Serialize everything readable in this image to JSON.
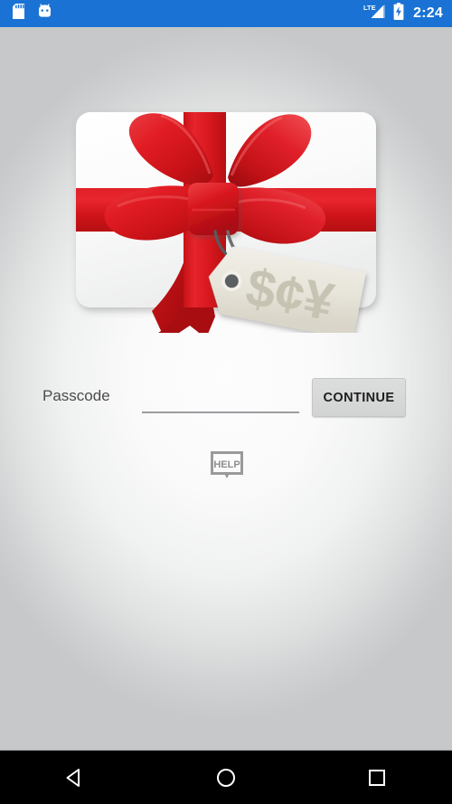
{
  "status_bar": {
    "background_color": "#1a73d4",
    "clock": "2:24",
    "left_icons": [
      {
        "name": "sd-card-icon",
        "label": "SD card"
      },
      {
        "name": "android-head-icon",
        "label": "Android system"
      }
    ],
    "right_icons": [
      {
        "name": "lte-signal-icon",
        "label": "LTE",
        "signal_text": "LTE"
      },
      {
        "name": "battery-charging-icon",
        "label": "Battery charging"
      }
    ]
  },
  "illustration": {
    "name": "gift-card-with-bow-and-price-tag",
    "alt": "White gift card wrapped in a red ribbon bow with a beige price tag",
    "tag_text": "$¢¥",
    "ribbon_color": "#d81921",
    "ribbon_dark_color": "#a50f14",
    "card_color": "#fbfbfb",
    "tag_color": "#e9e6dd",
    "tag_text_color": "#c7c3b2"
  },
  "form": {
    "passcode_label": "Passcode",
    "passcode_value": "",
    "passcode_placeholder": "",
    "continue_label": "CONTINUE",
    "continue_bg_color": "#d6d7d7"
  },
  "help": {
    "label": "HELP",
    "icon": "help-speech-bubble-icon",
    "color": "#9a9a9a"
  },
  "nav_bar": {
    "background_color": "#000000",
    "buttons": [
      {
        "name": "nav-back-button",
        "label": "Back",
        "icon": "triangle-left-icon"
      },
      {
        "name": "nav-home-button",
        "label": "Home",
        "icon": "circle-icon"
      },
      {
        "name": "nav-recents-button",
        "label": "Recent apps",
        "icon": "square-icon"
      }
    ]
  }
}
